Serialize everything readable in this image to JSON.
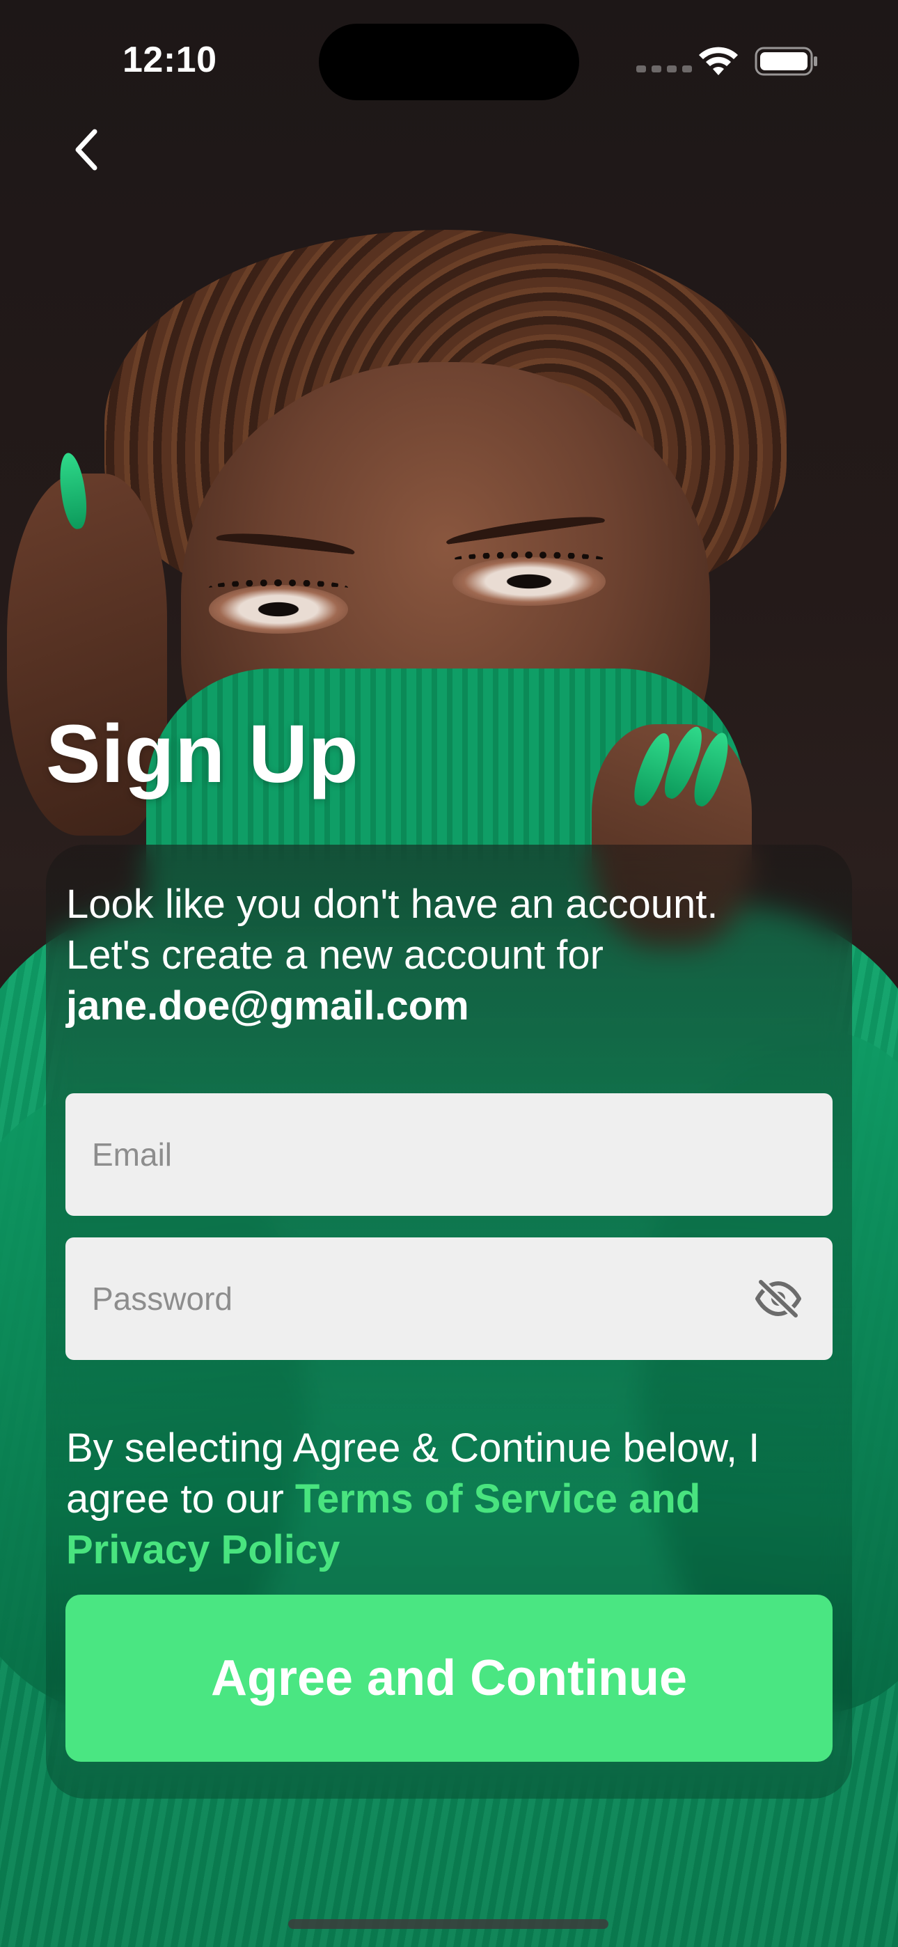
{
  "status_bar": {
    "time": "12:10"
  },
  "title": "Sign Up",
  "intro": {
    "line1": "Look like you don't have an account.",
    "line2": "Let's create a new account for",
    "email": "jane.doe@gmail.com"
  },
  "form": {
    "email_placeholder": "Email",
    "password_placeholder": "Password"
  },
  "terms": {
    "prefix": "By selecting Agree & Continue below, I agree to our ",
    "link": "Terms of Service and Privacy Policy"
  },
  "cta_label": "Agree and Continue",
  "colors": {
    "accent": "#4ae682",
    "link": "#49e47f",
    "field_bg": "#efefef"
  },
  "icons": {
    "back": "chevron-left-icon",
    "password_toggle": "eye-off-icon",
    "wifi": "wifi-icon",
    "battery": "battery-icon"
  }
}
